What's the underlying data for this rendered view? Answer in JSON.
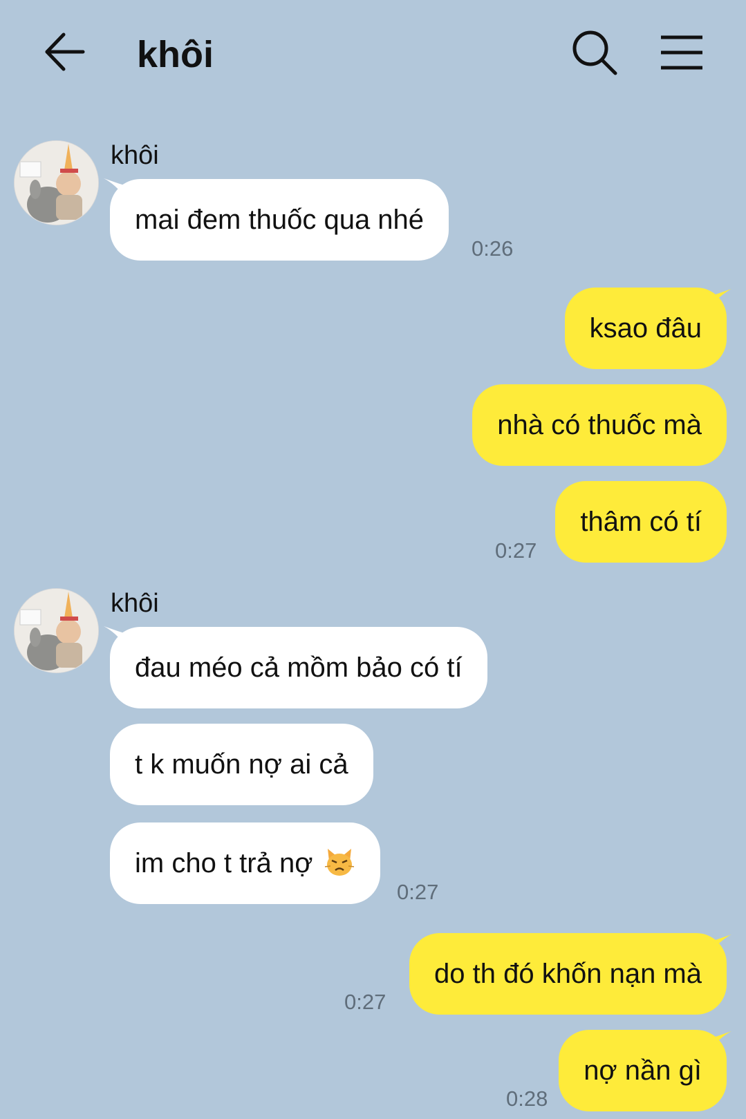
{
  "header": {
    "back_icon": "arrow-left-icon",
    "title": "khôi",
    "search_icon": "search-icon",
    "menu_icon": "hamburger-menu-icon"
  },
  "colors": {
    "background": "#b2c7da",
    "incoming_bubble": "#ffffff",
    "outgoing_bubble": "#feeb3a",
    "timestamp": "#5f6d7a"
  },
  "messages": [
    {
      "direction": "in",
      "sender": "khôi",
      "text": "mai đem thuốc qua nhé",
      "time": "0:26"
    },
    {
      "direction": "out",
      "text": "ksao đâu",
      "time": ""
    },
    {
      "direction": "out",
      "text": "nhà có thuốc mà",
      "time": ""
    },
    {
      "direction": "out",
      "text": "thâm có tí",
      "time": "0:27"
    },
    {
      "direction": "in",
      "sender": "khôi",
      "text": "đau méo cả mồm bảo có tí",
      "time": ""
    },
    {
      "direction": "in",
      "text": "t k muốn nợ ai cả",
      "time": ""
    },
    {
      "direction": "in",
      "text": "im cho t trả nợ",
      "emoji": "pouting-cat-emoji",
      "time": "0:27"
    },
    {
      "direction": "out",
      "text": "do th đó khốn nạn mà",
      "time": "0:27"
    },
    {
      "direction": "out",
      "text": "nợ nần gì",
      "time": "0:28"
    }
  ]
}
